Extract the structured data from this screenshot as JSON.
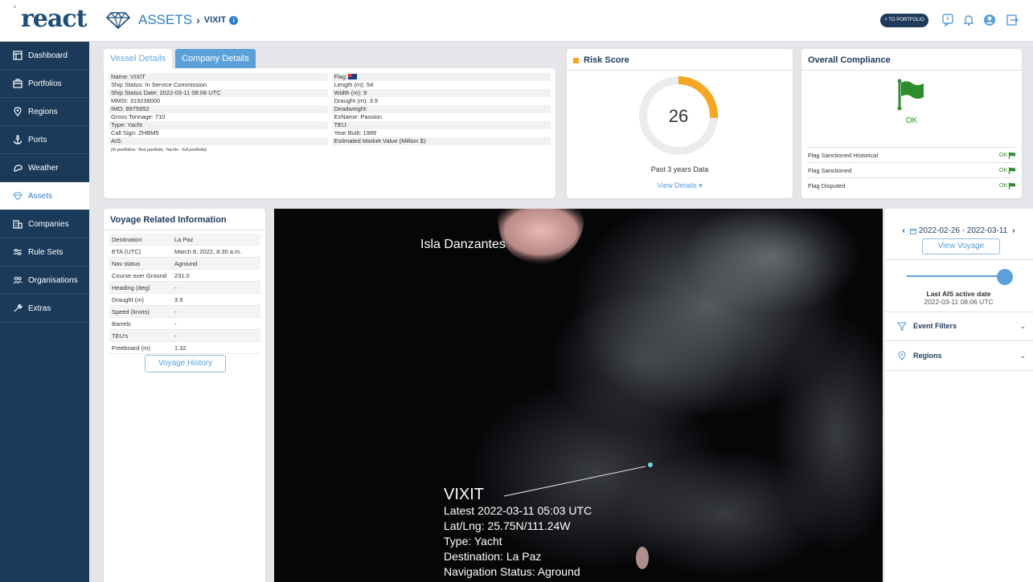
{
  "app": {
    "logo": "react",
    "logo_mark": "ʻ"
  },
  "header": {
    "section": "ASSETS",
    "separator": "›",
    "subject": "VIXIT",
    "info_glyph": "i",
    "to_portfolio": "+ TO PORTFOLIO"
  },
  "sidebar": {
    "items": [
      {
        "label": "Dashboard",
        "icon": "dashboard-icon"
      },
      {
        "label": "Portfolios",
        "icon": "portfolio-icon"
      },
      {
        "label": "Regions",
        "icon": "map-pin-icon"
      },
      {
        "label": "Ports",
        "icon": "anchor-icon"
      },
      {
        "label": "Weather",
        "icon": "weather-icon"
      },
      {
        "label": "Assets",
        "icon": "diamond-icon",
        "active": true
      },
      {
        "label": "Companies",
        "icon": "building-icon"
      },
      {
        "label": "Rule Sets",
        "icon": "rules-icon"
      },
      {
        "label": "Organisations",
        "icon": "users-icon"
      },
      {
        "label": "Extras",
        "icon": "tools-icon"
      }
    ]
  },
  "tabs": {
    "vessel_details": "Vessel Details",
    "company_details": "Company Details"
  },
  "vessel": {
    "left": [
      "Name: VIXIT",
      "Ship Status: In Service Commission",
      "Ship Status Date: 2022-03-11 08:06 UTC",
      "MMSI: 319238000",
      "IMO: 8975952",
      "Gross Tonnage: 710",
      "Type: Yacht",
      "Call Sign: ZHBM5",
      "AIS:"
    ],
    "right": [
      "Flag:",
      "Length (m): 54",
      "Width (m): 9",
      "Draught (m): 3.9",
      "Deadweight:",
      "ExName: Passion",
      "TEU:",
      "Year Built: 1989",
      "Estimated Market Value (Million $):"
    ],
    "note": "(In portfolios: Test portfolio, Yachts - full portfolio)"
  },
  "risk": {
    "title": "Risk Score",
    "score": "26",
    "score_fraction": 0.26,
    "subtitle": "Past 3 years Data",
    "link": "View Details ▾",
    "accent": "#f5a623"
  },
  "compliance": {
    "title": "Overall Compliance",
    "status": "OK",
    "rows": [
      {
        "label": "Flag Sanctioned Historical",
        "status": "OK"
      },
      {
        "label": "Flag Sanctioned",
        "status": "OK"
      },
      {
        "label": "Flag Disputed",
        "status": "OK"
      }
    ],
    "ok_color": "#2e8b2e"
  },
  "voyage": {
    "title": "Voyage Related Information",
    "rows": [
      {
        "k": "Destination",
        "v": "La Paz"
      },
      {
        "k": "ETA (UTC)",
        "v": "March 8, 2022, 8:30 a.m."
      },
      {
        "k": "Nav status",
        "v": "Aground"
      },
      {
        "k": "Course over Ground",
        "v": "231.0"
      },
      {
        "k": "Heading (deg)",
        "v": "-"
      },
      {
        "k": "Draught (m)",
        "v": "3.9"
      },
      {
        "k": "Speed (knots)",
        "v": "-"
      },
      {
        "k": "Barrels",
        "v": "-"
      },
      {
        "k": "TEU's",
        "v": "-"
      },
      {
        "k": "Freeboard (m)",
        "v": "1.32"
      }
    ],
    "history_button": "Voyage History"
  },
  "map": {
    "place_label": "Isla Danzantes",
    "vessel_name": "VIXIT",
    "latest": "Latest 2022-03-11 05:03 UTC",
    "latlng": "Lat/Lng:   25.75N/111.24W",
    "type": "Type:  Yacht",
    "destination": "Destination:   La Paz",
    "nav_status": "Navigation Status:     Aground"
  },
  "right_panel": {
    "prev": "‹",
    "next": "›",
    "date_range": "2022-02-26 - 2022-03-11",
    "view_voyage": "View Voyage",
    "ais_label": "Last AIS active date",
    "ais_value": "2022-03-11 08:06 UTC",
    "event_filters": "Event Filters",
    "regions": "Regions",
    "chevron": "⌄"
  }
}
